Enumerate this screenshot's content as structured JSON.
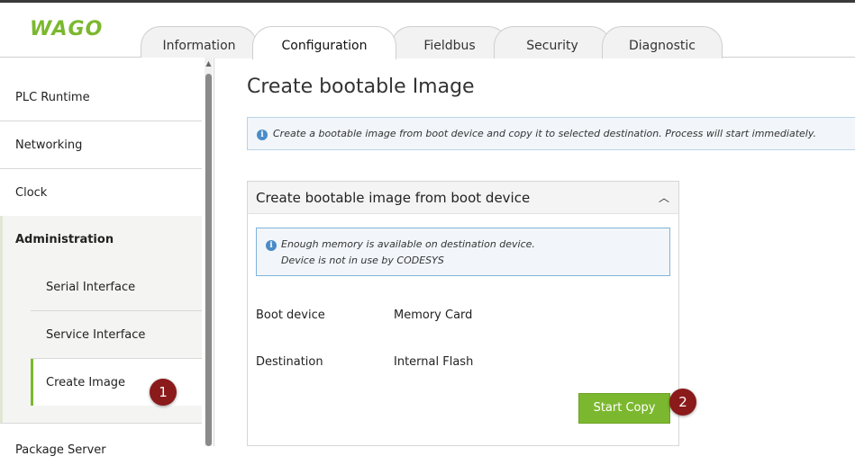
{
  "header": {
    "logo_text": "WAGO",
    "tabs": [
      {
        "label": "Information",
        "active": false
      },
      {
        "label": "Configuration",
        "active": true
      },
      {
        "label": "Fieldbus",
        "active": false
      },
      {
        "label": "Security",
        "active": false
      },
      {
        "label": "Diagnostic",
        "active": false
      }
    ]
  },
  "sidebar": {
    "items": [
      {
        "label": "PLC Runtime"
      },
      {
        "label": "Networking"
      },
      {
        "label": "Clock"
      },
      {
        "label": "Administration"
      },
      {
        "label": "Package Server"
      }
    ],
    "subitems": [
      {
        "label": "Serial Interface"
      },
      {
        "label": "Service Interface"
      },
      {
        "label": "Create Image",
        "active": true
      }
    ]
  },
  "main": {
    "title": "Create bootable Image",
    "info_message": "Create a bootable image from boot device and copy it to selected destination. Process will start immediately.",
    "panel": {
      "title": "Create bootable image from boot device",
      "collapse_icon": "chevron-up-icon",
      "note_lines": [
        "Enough memory is available on destination device.",
        "Device is not in use by CODESYS"
      ],
      "fields": [
        {
          "label": "Boot device",
          "value": "Memory Card"
        },
        {
          "label": "Destination",
          "value": "Internal Flash"
        }
      ],
      "button_label": "Start Copy"
    }
  },
  "badges": [
    "1",
    "2"
  ],
  "colors": {
    "brand": "#7cb82f",
    "info_border": "#7fb3da",
    "badge": "#8b1a1a"
  }
}
